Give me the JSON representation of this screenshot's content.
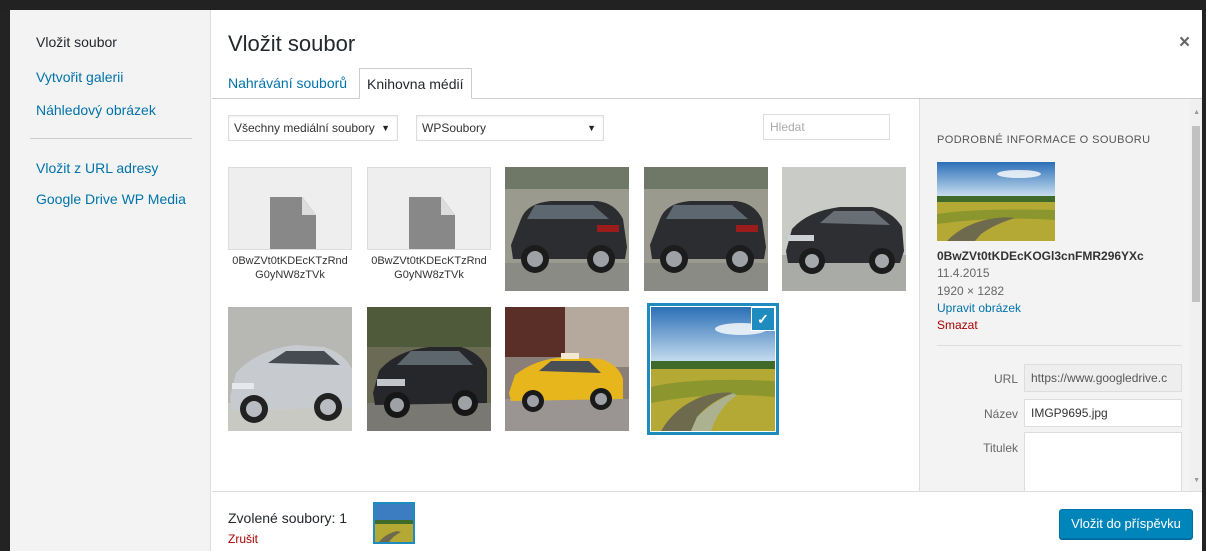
{
  "menu": {
    "items": [
      {
        "label": "Vložit soubor"
      },
      {
        "label": "Vytvořit galerii"
      },
      {
        "label": "Náhledový obrázek"
      },
      {
        "label": "Vložit z URL adresy"
      },
      {
        "label": "Google Drive WP Media"
      }
    ]
  },
  "modal": {
    "title": "Vložit soubor",
    "close_label": "×"
  },
  "tabs": [
    {
      "label": "Nahrávání souborů"
    },
    {
      "label": "Knihovna médií"
    }
  ],
  "toolbar": {
    "type_filter": "Všechny mediální soubory",
    "source_filter": "WPSoubory",
    "search_placeholder": "Hledat"
  },
  "files": [
    {
      "kind": "document",
      "name": "0BwZVt0tKDEcKTzRndG0yNW8zTVk"
    },
    {
      "kind": "document",
      "name": "0BwZVt0tKDEcKTzRndG0yNW8zTVk"
    },
    {
      "kind": "photo",
      "subject": "dark station wagon"
    },
    {
      "kind": "photo",
      "subject": "dark station wagon"
    },
    {
      "kind": "photo",
      "subject": "dark sedan"
    },
    {
      "kind": "photo",
      "subject": "silver hatchback"
    },
    {
      "kind": "photo",
      "subject": "dark station wagon"
    },
    {
      "kind": "photo",
      "subject": "yellow taxi"
    },
    {
      "kind": "photo",
      "subject": "green field with path",
      "selected": true
    }
  ],
  "details": {
    "heading": "PODROBNÉ INFORMACE O SOUBORU",
    "filename": "0BwZVt0tKDEcKOGl3cnFMR296YXc",
    "date": "11.4.2015",
    "dimensions": "1920 × 1282",
    "edit_link": "Upravit obrázek",
    "delete_link": "Smazat",
    "fields": {
      "url_label": "URL",
      "url_value": "https://www.googledrive.c",
      "title_label": "Název",
      "title_value": "IMGP9695.jpg",
      "caption_label": "Titulek"
    }
  },
  "footer": {
    "selected_label": "Zvolené soubory: 1",
    "cancel_label": "Zrušit",
    "insert_button": "Vložit do příspěvku"
  },
  "colors": {
    "accent": "#0085ba",
    "link": "#0073aa",
    "danger": "#a00",
    "selection": "#1e8cbe"
  }
}
